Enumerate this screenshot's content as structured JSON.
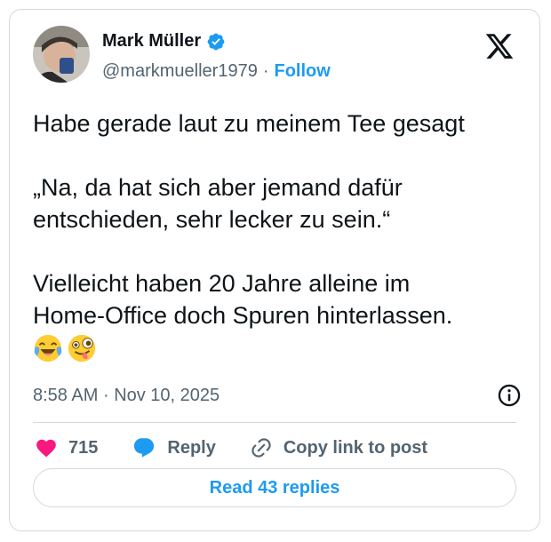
{
  "author": {
    "name": "Mark Müller",
    "handle": "@markmueller1979",
    "separator": "·",
    "follow_label": "Follow"
  },
  "tweet": {
    "lines": [
      "Habe gerade laut zu meinem Tee gesagt",
      "„Na, da hat sich aber jemand dafür",
      "entschieden, sehr lecker zu sein.“",
      "Vielleicht haben 20 Jahre alleine im",
      "Home-Office doch Spuren hinterlassen."
    ],
    "emojis": [
      "face-with-tears-of-joy",
      "zany-face"
    ],
    "time": "8:58 AM",
    "date_separator": "·",
    "date": "Nov 10, 2025"
  },
  "actions": {
    "like_count": "715",
    "reply_label": "Reply",
    "copy_link_label": "Copy link to post"
  },
  "read_replies_label": "Read 43 replies",
  "colors": {
    "accent": "#1d9bf0",
    "like": "#f91880",
    "text": "#0f1419",
    "muted": "#536471",
    "border": "#cfd9de"
  }
}
